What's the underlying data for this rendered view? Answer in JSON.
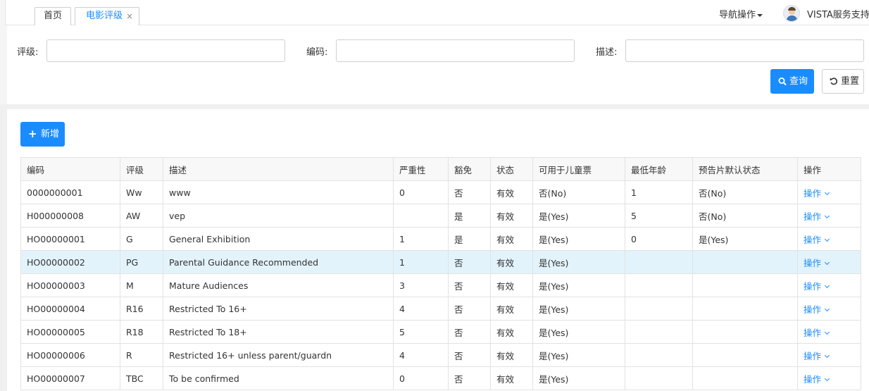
{
  "tabs": [
    {
      "label": "首页",
      "active": false
    },
    {
      "label": "电影评级",
      "active": true,
      "close": "×"
    }
  ],
  "header": {
    "nav_ops": "导航操作",
    "user_name": "VISTA服务支持"
  },
  "search": {
    "rating_label": "评级:",
    "code_label": "编码:",
    "desc_label": "描述:",
    "rating_value": "",
    "code_value": "",
    "desc_value": "",
    "query_label": "查询",
    "reset_label": "重置"
  },
  "toolbar": {
    "add_label": "新增"
  },
  "table": {
    "columns": [
      "编码",
      "评级",
      "描述",
      "严重性",
      "豁免",
      "状态",
      "可用于儿童票",
      "最低年龄",
      "预告片默认状态",
      "操作"
    ],
    "rows": [
      {
        "code": "0000000001",
        "rating": "Ww",
        "desc": "www",
        "severity": "0",
        "exempt": "否",
        "status": "有效",
        "child": "否(No)",
        "min_age": "1",
        "trailer": "否(No)",
        "op": "操作"
      },
      {
        "code": "H000000008",
        "rating": "AW",
        "desc": "vep",
        "severity": "",
        "exempt": "是",
        "status": "有效",
        "child": "是(Yes)",
        "min_age": "5",
        "trailer": "否(No)",
        "op": "操作"
      },
      {
        "code": "HO00000001",
        "rating": "G",
        "desc": "General Exhibition",
        "severity": "1",
        "exempt": "是",
        "status": "有效",
        "child": "是(Yes)",
        "min_age": "0",
        "trailer": "是(Yes)",
        "op": "操作"
      },
      {
        "code": "HO00000002",
        "rating": "PG",
        "desc": "Parental Guidance Recommended",
        "severity": "1",
        "exempt": "否",
        "status": "有效",
        "child": "是(Yes)",
        "min_age": "",
        "trailer": "",
        "op": "操作"
      },
      {
        "code": "HO00000003",
        "rating": "M",
        "desc": "Mature Audiences",
        "severity": "3",
        "exempt": "否",
        "status": "有效",
        "child": "是(Yes)",
        "min_age": "",
        "trailer": "",
        "op": "操作"
      },
      {
        "code": "HO00000004",
        "rating": "R16",
        "desc": "Restricted To 16+",
        "severity": "4",
        "exempt": "否",
        "status": "有效",
        "child": "是(Yes)",
        "min_age": "",
        "trailer": "",
        "op": "操作"
      },
      {
        "code": "HO00000005",
        "rating": "R18",
        "desc": "Restricted To 18+",
        "severity": "5",
        "exempt": "否",
        "status": "有效",
        "child": "是(Yes)",
        "min_age": "",
        "trailer": "",
        "op": "操作"
      },
      {
        "code": "HO00000006",
        "rating": "R",
        "desc": "Restricted 16+ unless parent/guardn",
        "severity": "4",
        "exempt": "否",
        "status": "有效",
        "child": "是(Yes)",
        "min_age": "",
        "trailer": "",
        "op": "操作"
      },
      {
        "code": "HO00000007",
        "rating": "TBC",
        "desc": "To be confirmed",
        "severity": "0",
        "exempt": "否",
        "status": "有效",
        "child": "是(Yes)",
        "min_age": "",
        "trailer": "",
        "op": "操作"
      }
    ]
  },
  "colors": {
    "accent": "#1a8cff",
    "highlight_row": "#e3f3fb"
  }
}
